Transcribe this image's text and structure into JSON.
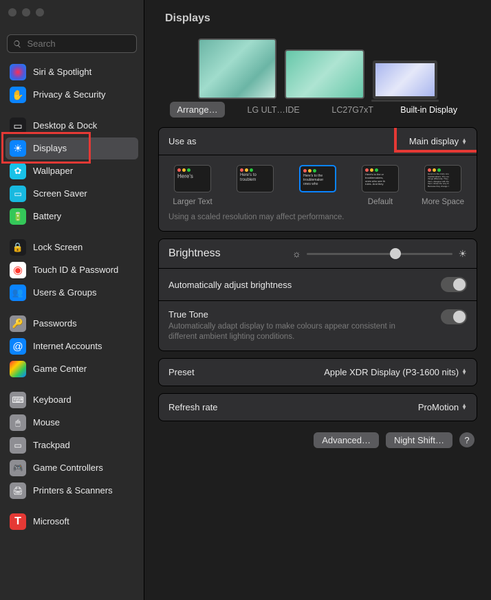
{
  "header": {
    "title": "Displays"
  },
  "search": {
    "placeholder": "Search"
  },
  "sidebar": {
    "items": [
      {
        "id": "siri",
        "label": "Siri & Spotlight",
        "bg": "#1c1c1e"
      },
      {
        "id": "privacy",
        "label": "Privacy & Security",
        "bg": "#0a84ff"
      },
      {
        "id": "desktop",
        "label": "Desktop & Dock",
        "bg": "#1c1c1e"
      },
      {
        "id": "displays",
        "label": "Displays",
        "bg": "#0a84ff",
        "selected": true
      },
      {
        "id": "wallpaper",
        "label": "Wallpaper",
        "bg": "#19c2e8"
      },
      {
        "id": "screensaver",
        "label": "Screen Saver",
        "bg": "#18b9e0"
      },
      {
        "id": "battery",
        "label": "Battery",
        "bg": "#34c759"
      },
      {
        "id": "lock",
        "label": "Lock Screen",
        "bg": "#1c1c1e"
      },
      {
        "id": "touchid",
        "label": "Touch ID & Password",
        "bg": "#ff3b30"
      },
      {
        "id": "users",
        "label": "Users & Groups",
        "bg": "#0a84ff"
      },
      {
        "id": "passwords",
        "label": "Passwords",
        "bg": "#8e8e93"
      },
      {
        "id": "internet",
        "label": "Internet Accounts",
        "bg": "#0a84ff"
      },
      {
        "id": "gamecenter",
        "label": "Game Center",
        "bg": "linear-gradient(135deg,#ff3b30,#ffcc00,#34c759,#0a84ff)"
      },
      {
        "id": "keyboard",
        "label": "Keyboard",
        "bg": "#8e8e93"
      },
      {
        "id": "mouse",
        "label": "Mouse",
        "bg": "#8e8e93"
      },
      {
        "id": "trackpad",
        "label": "Trackpad",
        "bg": "#8e8e93"
      },
      {
        "id": "gamectrl",
        "label": "Game Controllers",
        "bg": "#8e8e93"
      },
      {
        "id": "printers",
        "label": "Printers & Scanners",
        "bg": "#8e8e93"
      },
      {
        "id": "microsoft",
        "label": "Microsoft",
        "bg": "#e53935"
      }
    ]
  },
  "displays": {
    "arrange_label": "Arrange…",
    "monitors": [
      {
        "name": "LG ULT…IDE"
      },
      {
        "name": "LC27G7xT"
      },
      {
        "name": "Built-in Display",
        "active": true
      }
    ]
  },
  "use_as": {
    "label": "Use as",
    "value": "Main display"
  },
  "resolutions": {
    "items": [
      {
        "label": "Larger Text"
      },
      {
        "label": ""
      },
      {
        "label": "",
        "selected": true
      },
      {
        "label": "Default"
      },
      {
        "label": "More Space"
      }
    ],
    "sample": "Here's to the troublemakers, ones who",
    "note": "Using a scaled resolution may affect performance."
  },
  "brightness": {
    "label": "Brightness"
  },
  "auto_bright": {
    "label": "Automatically adjust brightness",
    "on": true
  },
  "true_tone": {
    "label": "True Tone",
    "desc": "Automatically adapt display to make colours appear consistent in different ambient lighting conditions.",
    "on": true
  },
  "preset": {
    "label": "Preset",
    "value": "Apple XDR Display (P3-1600 nits)"
  },
  "refresh": {
    "label": "Refresh rate",
    "value": "ProMotion"
  },
  "footer": {
    "advanced": "Advanced…",
    "night": "Night Shift…",
    "help": "?"
  }
}
